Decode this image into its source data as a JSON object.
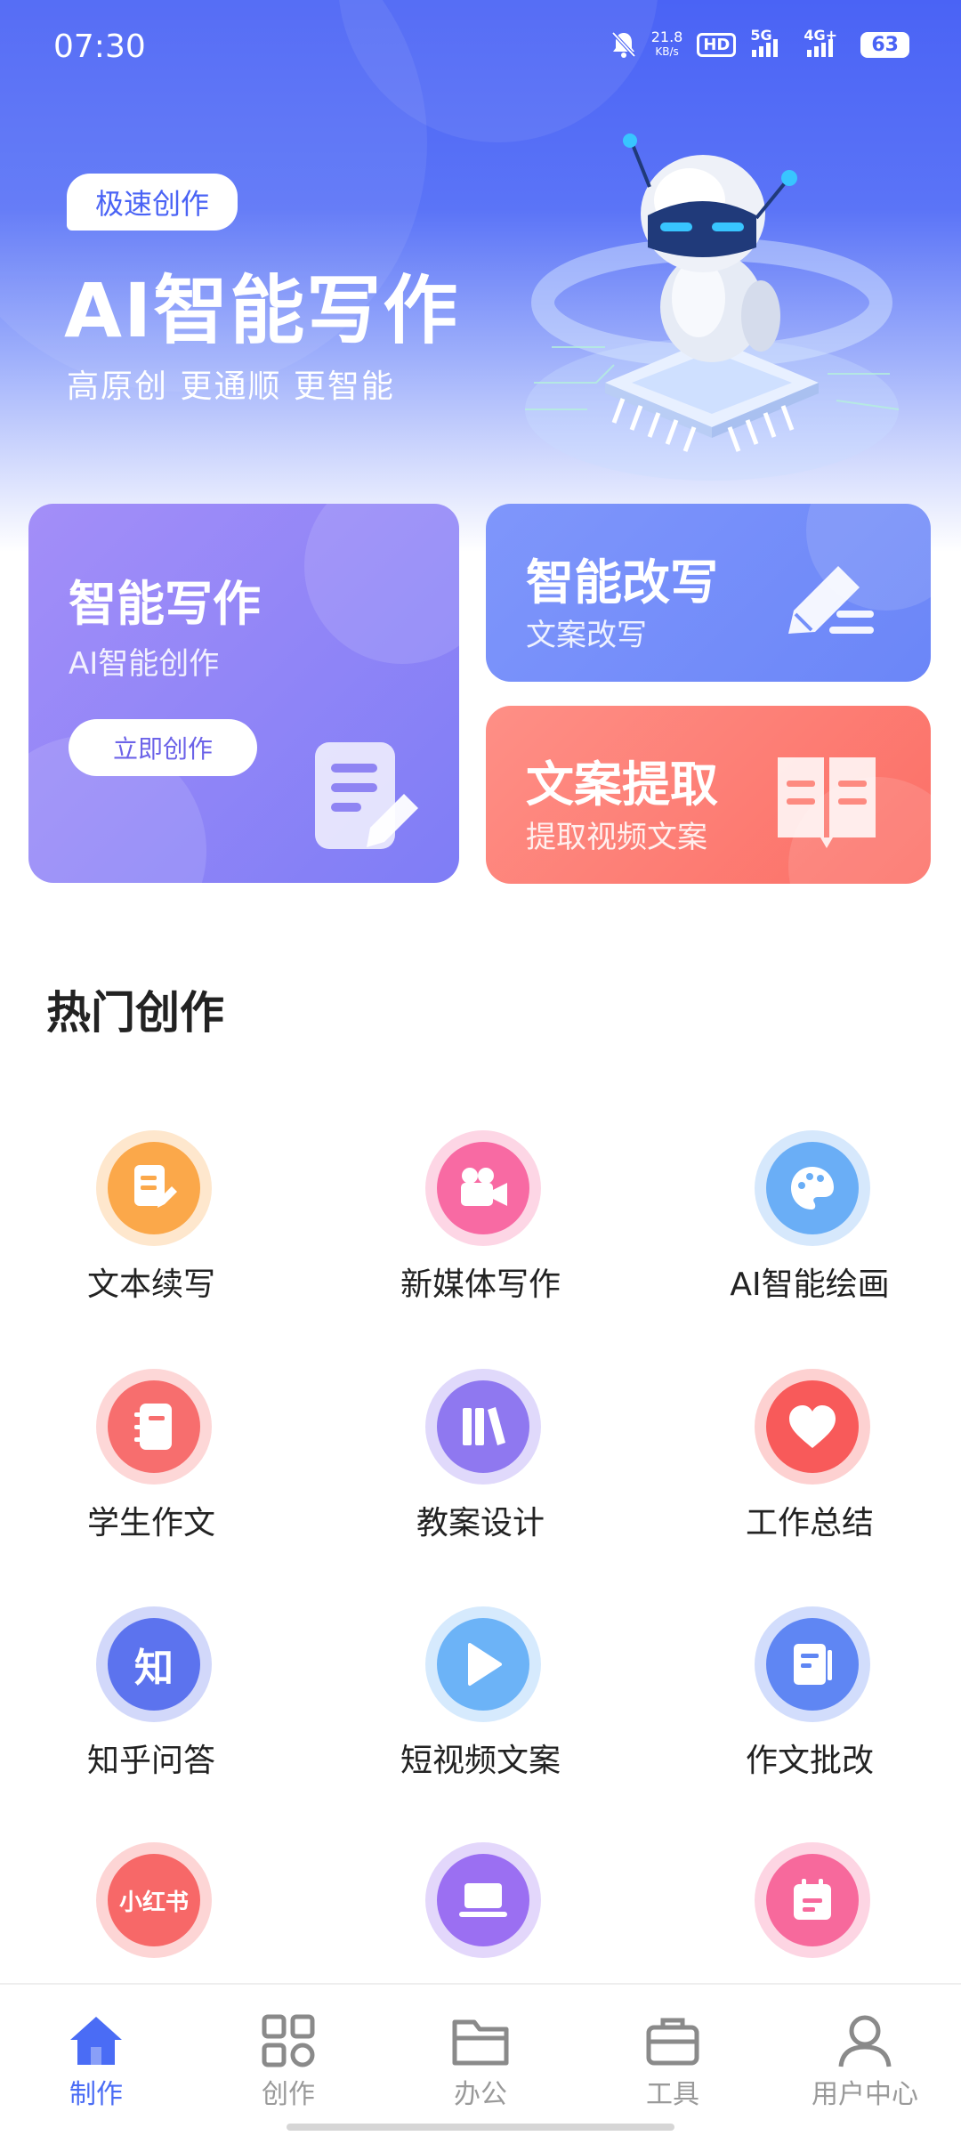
{
  "status": {
    "time": "07:30",
    "net_speed": "21.8",
    "net_unit": "KB/s",
    "hd": "HD",
    "sim1": "5G",
    "sim2": "4G+",
    "battery": "63"
  },
  "hero": {
    "tag": "极速创作",
    "title": "AI智能写作",
    "subtitle": "高原创  更通顺  更智能"
  },
  "cards": {
    "write": {
      "title": "智能写作",
      "subtitle": "AI智能创作",
      "button": "立即创作"
    },
    "rewrite": {
      "title": "智能改写",
      "subtitle": "文案改写"
    },
    "extract": {
      "title": "文案提取",
      "subtitle": "提取视频文案"
    }
  },
  "hot": {
    "title": "热门创作",
    "items": [
      {
        "label": "文本续写",
        "icon": "document-edit-icon",
        "color": "#fba84a"
      },
      {
        "label": "新媒体写作",
        "icon": "video-camera-icon",
        "color": "#f86aa3"
      },
      {
        "label": "AI智能绘画",
        "icon": "palette-icon",
        "color": "#6aaef6"
      },
      {
        "label": "学生作文",
        "icon": "notebook-icon",
        "color": "#f76e6e"
      },
      {
        "label": "教案设计",
        "icon": "books-icon",
        "color": "#8f78f0"
      },
      {
        "label": "工作总结",
        "icon": "heart-icon",
        "color": "#f85a5a"
      },
      {
        "label": "知乎问答",
        "icon": "zhihu-icon",
        "icon_text": "知",
        "color": "#5c73ee"
      },
      {
        "label": "短视频文案",
        "icon": "play-icon",
        "color": "#6cb3f7"
      },
      {
        "label": "作文批改",
        "icon": "document-icon",
        "color": "#5f86f3"
      },
      {
        "label": "",
        "icon": "xiaohongshu-icon",
        "icon_text": "小红书",
        "color": "#f76868"
      },
      {
        "label": "",
        "icon": "laptop-icon",
        "color": "#9b6ff2"
      },
      {
        "label": "",
        "icon": "calendar-icon",
        "color": "#f7699c"
      }
    ]
  },
  "nav": {
    "items": [
      {
        "label": "制作",
        "icon": "home-icon",
        "active": true
      },
      {
        "label": "创作",
        "icon": "grid-icon",
        "active": false
      },
      {
        "label": "办公",
        "icon": "folder-icon",
        "active": false
      },
      {
        "label": "工具",
        "icon": "briefcase-icon",
        "active": false
      },
      {
        "label": "用户中心",
        "icon": "user-icon",
        "active": false
      }
    ]
  },
  "colors": {
    "primary": "#4a63f5",
    "card_write": "#8e85f7",
    "card_rewrite": "#7590fa",
    "card_extract": "#fd7f76",
    "nav_active": "#4a6cf5",
    "nav_inactive": "#9a9a9a"
  }
}
